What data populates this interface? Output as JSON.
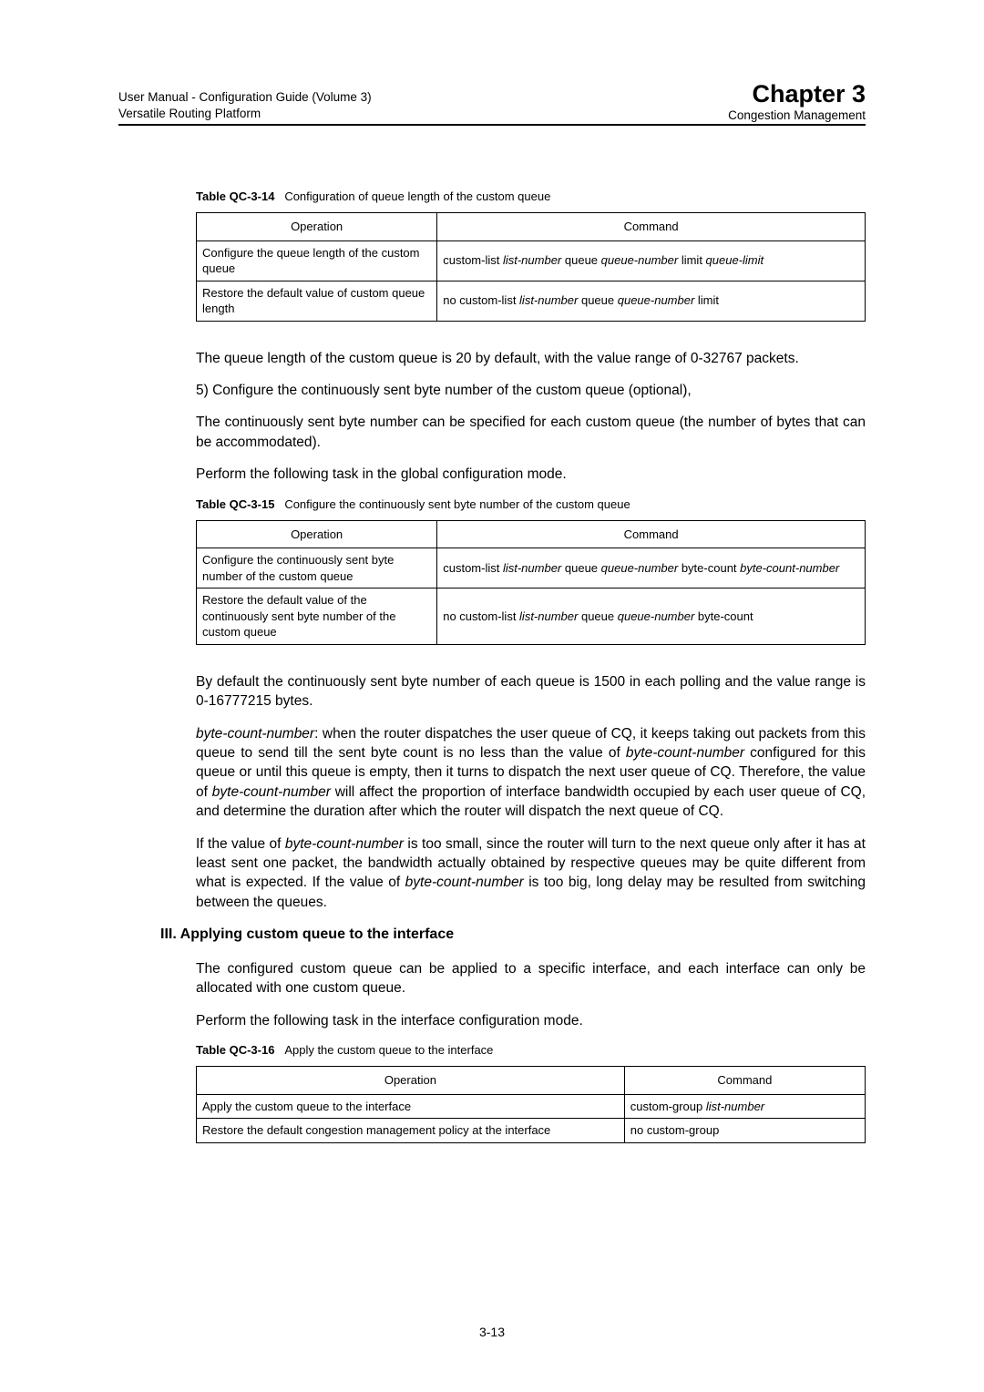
{
  "header": {
    "manual_line1": "User Manual - Configuration Guide (Volume 3)",
    "manual_line2": "Versatile Routing Platform",
    "chapter": "Chapter 3",
    "chapter_sub": "Congestion Management"
  },
  "tables": {
    "t14_caption_bold": "Table QC-3-14",
    "t14_caption": "Configuration of queue length of the custom queue",
    "t14_h1": "Operation",
    "t14_h2": "Command",
    "t14_r1c1": "Configure the queue length of the custom queue",
    "t14_r1c2_a": "custom-list ",
    "t14_r1c2_b": "list-number ",
    "t14_r1c2_c": "queue ",
    "t14_r1c2_d": "queue-number ",
    "t14_r1c2_e": "limit ",
    "t14_r1c2_f": "queue-limit",
    "t14_r2c1": "Restore the  default value of custom queue length",
    "t14_r2c2_a": "no custom-list ",
    "t14_r2c2_b": "list-number ",
    "t14_r2c2_c": "queue ",
    "t14_r2c2_d": "queue-number ",
    "t14_r2c2_e": "limit",
    "t15_caption_bold": "Table QC-3-15",
    "t15_caption": "Configure the continuously sent byte number of the custom queue",
    "t15_h1": "Operation",
    "t15_h2": "Command",
    "t15_r1c1": "Configure the continuously sent byte number of the custom queue",
    "t15_r1c2_a": "custom-list ",
    "t15_r1c2_b": "list-number ",
    "t15_r1c2_c": "queue ",
    "t15_r1c2_d": "queue-number ",
    "t15_r1c2_e": "byte-count ",
    "t15_r1c2_f": "byte-count-number",
    "t15_r2c1": "Restore  the default value of the continuously sent byte number of the custom queue",
    "t15_r2c2_a": "no custom-list ",
    "t15_r2c2_b": "list-number ",
    "t15_r2c2_c": "queue ",
    "t15_r2c2_d": "queue-number ",
    "t15_r2c2_e": "byte-count",
    "t16_caption_bold": "Table QC-3-16",
    "t16_caption": "Apply the custom queue to the interface",
    "t16_h1": "Operation",
    "t16_h2": "Command",
    "t16_r1c1": "Apply the custom queue to  the interface",
    "t16_r1c2_a": "custom-group ",
    "t16_r1c2_b": "list-number",
    "t16_r2c1": "Restore the default  congestion management policy at the interface",
    "t16_r2c2": "no custom-group"
  },
  "paras": {
    "p1": "The queue length of the custom queue is 20 by default, with the value range of 0-32767 packets.",
    "p2": "5)    Configure the continuously sent byte number of the custom queue (optional),",
    "p3": "The continuously sent byte number can be specified for each custom queue (the number of bytes that can be accommodated).",
    "p4": "Perform the following task in the global configuration mode.",
    "p5": "By default the continuously sent byte number of each queue is 1500 in each polling and the value range is 0-16777215 bytes.",
    "p6_i1": "byte-count-number",
    "p6_a": ": when the router dispatches the user queue of CQ, it keeps taking out packets from this queue to send till the sent byte count is no less than the value of ",
    "p6_i2": "byte-count-number",
    "p6_b": " configured for this queue or until this queue is empty, then it turns to dispatch the next user queue of CQ. Therefore, the value of ",
    "p6_i3": "byte-count-number",
    "p6_c": " will affect the proportion of interface bandwidth occupied by each user queue of CQ, and determine the duration after which the router will dispatch the next queue of CQ.",
    "p7_a": "If the value of ",
    "p7_i1": "byte-count-number",
    "p7_b": " is too small, since the router will turn to the next queue only after it has at least sent one packet, the bandwidth actually obtained by respective queues may be quite different from what is expected. If the value of ",
    "p7_i2": "byte-count-number",
    "p7_c": " is too big, long delay may be resulted from switching between the queues.",
    "heading3": "III. Applying custom queue to the interface",
    "p8": "The configured custom queue can be applied to a specific interface, and each interface can only be allocated with one custom queue.",
    "p9": "Perform the following task in the interface configuration mode.",
    "pagenum": "3-13"
  }
}
